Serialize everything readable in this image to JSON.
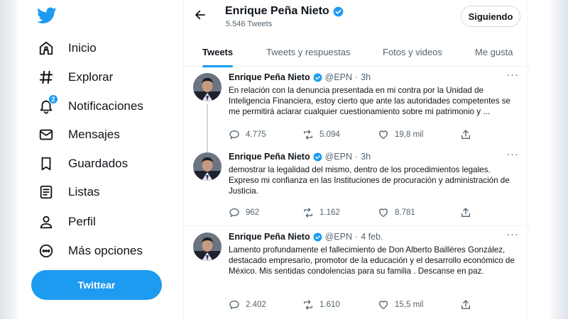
{
  "sidebar": {
    "logo_icon": "twitter-bird-icon",
    "items": [
      {
        "label": "Inicio",
        "icon": "home-icon"
      },
      {
        "label": "Explorar",
        "icon": "hashtag-icon"
      },
      {
        "label": "Notificaciones",
        "icon": "bell-icon",
        "badge": "2"
      },
      {
        "label": "Mensajes",
        "icon": "envelope-icon"
      },
      {
        "label": "Guardados",
        "icon": "bookmark-icon"
      },
      {
        "label": "Listas",
        "icon": "list-icon"
      },
      {
        "label": "Perfil",
        "icon": "person-icon"
      },
      {
        "label": "Más opciones",
        "icon": "more-circle-icon"
      }
    ],
    "tweet_button": "Twittear"
  },
  "header": {
    "name": "Enrique Peña Nieto",
    "tweet_count": "5.546 Tweets",
    "follow_button": "Siguiendo"
  },
  "tabs": [
    {
      "label": "Tweets",
      "active": true
    },
    {
      "label": "Tweets y respuestas",
      "active": false
    },
    {
      "label": "Fotos y videos",
      "active": false
    },
    {
      "label": "Me gusta",
      "active": false
    }
  ],
  "tweets": [
    {
      "name": "Enrique Peña Nieto",
      "handle": "@EPN",
      "time": "3h",
      "text": "En relación con la denuncia presentada en mi contra por la Unidad de Inteligencia Financiera,  estoy cierto que ante las autoridades competentes se me permitirá aclarar cualquier cuestionamiento sobre mi patrimonio y ...",
      "replies": "4.775",
      "retweets": "5.094",
      "likes": "19,8 mil"
    },
    {
      "name": "Enrique Peña Nieto",
      "handle": "@EPN",
      "time": "3h",
      "text": "demostrar la legalidad del mismo, dentro de los procedimientos  legales. Expreso mi confianza en las Instituciones de procuración y administración de Justicia.",
      "replies": "962",
      "retweets": "1.162",
      "likes": "8.781"
    },
    {
      "name": "Enrique Peña Nieto",
      "handle": "@EPN",
      "time": "4 feb.",
      "text": "Lamento  profundamente el fallecimiento de Don Alberto Baillères González, destacado empresario, promotor de la educación y el desarrollo económico de México.  Mis sentidas condolencias para su familia . Descanse en paz.",
      "replies": "2.402",
      "retweets": "1.610",
      "likes": "15,5 mil"
    }
  ],
  "colors": {
    "accent": "#1d9bf0",
    "text": "#0f1419",
    "muted": "#536471",
    "border": "#eff3f4"
  }
}
